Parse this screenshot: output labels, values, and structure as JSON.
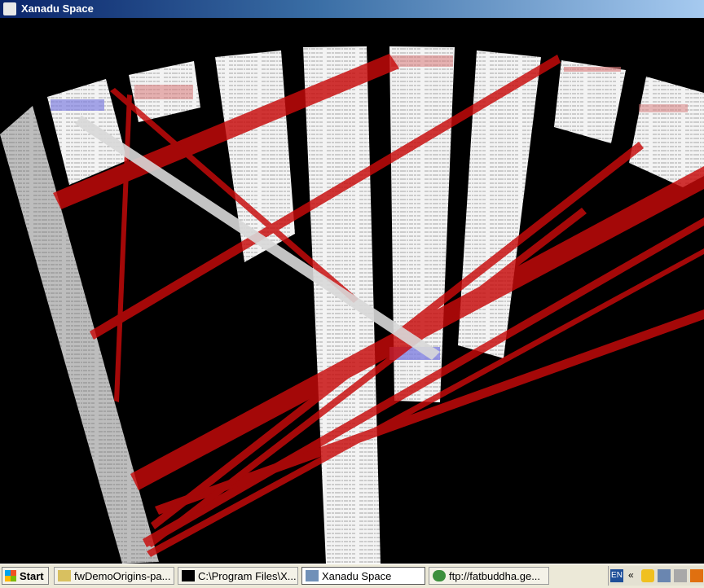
{
  "window": {
    "title": "Xanadu Space",
    "icon": "xanadu-eye-icon"
  },
  "colors": {
    "background": "#000000",
    "page": "#f3f3f3",
    "link_red": "#c80a0a",
    "link_white": "#d8d8d8",
    "highlight_blue": "#8080e0"
  },
  "taskbar": {
    "start_label": "Start",
    "tasks": [
      {
        "label": "fwDemoOrigins-pa...",
        "icon": "document-icon"
      },
      {
        "label": "C:\\Program Files\\X...",
        "icon": "console-icon"
      },
      {
        "label": "Xanadu Space",
        "icon": "xanadu-eye-icon",
        "active": true
      },
      {
        "label": "ftp://fatbuddha.ge...",
        "icon": "browser-icon"
      }
    ],
    "tray": {
      "language": "EN",
      "chevron": "«"
    }
  }
}
